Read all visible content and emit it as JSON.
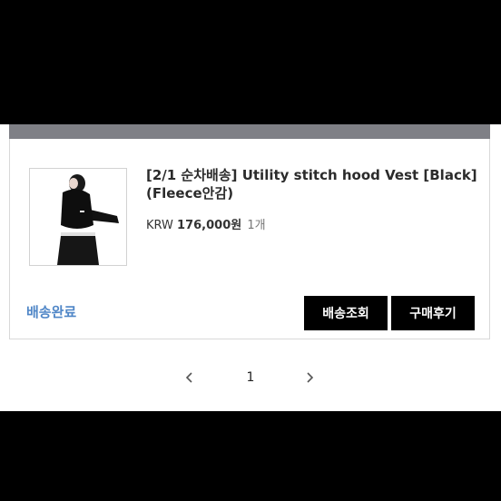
{
  "order": {
    "product_title": "[2/1 순차배송] Utility stitch hood Vest [Black] (Fleece안감)",
    "currency": "KRW",
    "amount": "176,000원",
    "quantity": "1개",
    "status": "배송완료"
  },
  "actions": {
    "tracking_label": "배송조회",
    "review_label": "구매후기"
  },
  "pagination": {
    "current_page": "1",
    "prev_icon": "chevron-left-icon",
    "next_icon": "chevron-right-icon"
  }
}
